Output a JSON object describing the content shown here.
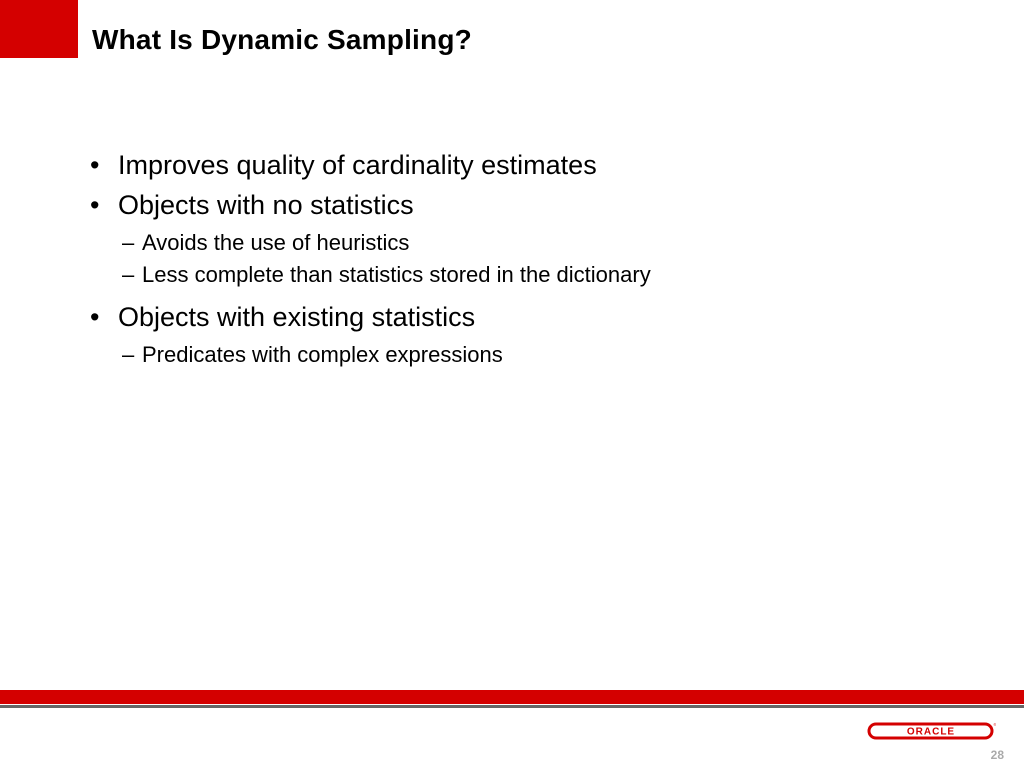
{
  "slide": {
    "title": "What Is Dynamic Sampling?",
    "bullets": [
      {
        "text": "Improves quality of cardinality estimates",
        "subs": []
      },
      {
        "text": "Objects with no statistics",
        "subs": [
          "Avoids the use of heuristics",
          "Less complete than statistics stored in the dictionary"
        ]
      },
      {
        "text": "Objects with existing statistics",
        "subs": [
          "Predicates with complex expressions"
        ]
      }
    ]
  },
  "footer": {
    "logo_text": "ORACLE",
    "page_number": "28",
    "accent_color": "#d40000"
  }
}
